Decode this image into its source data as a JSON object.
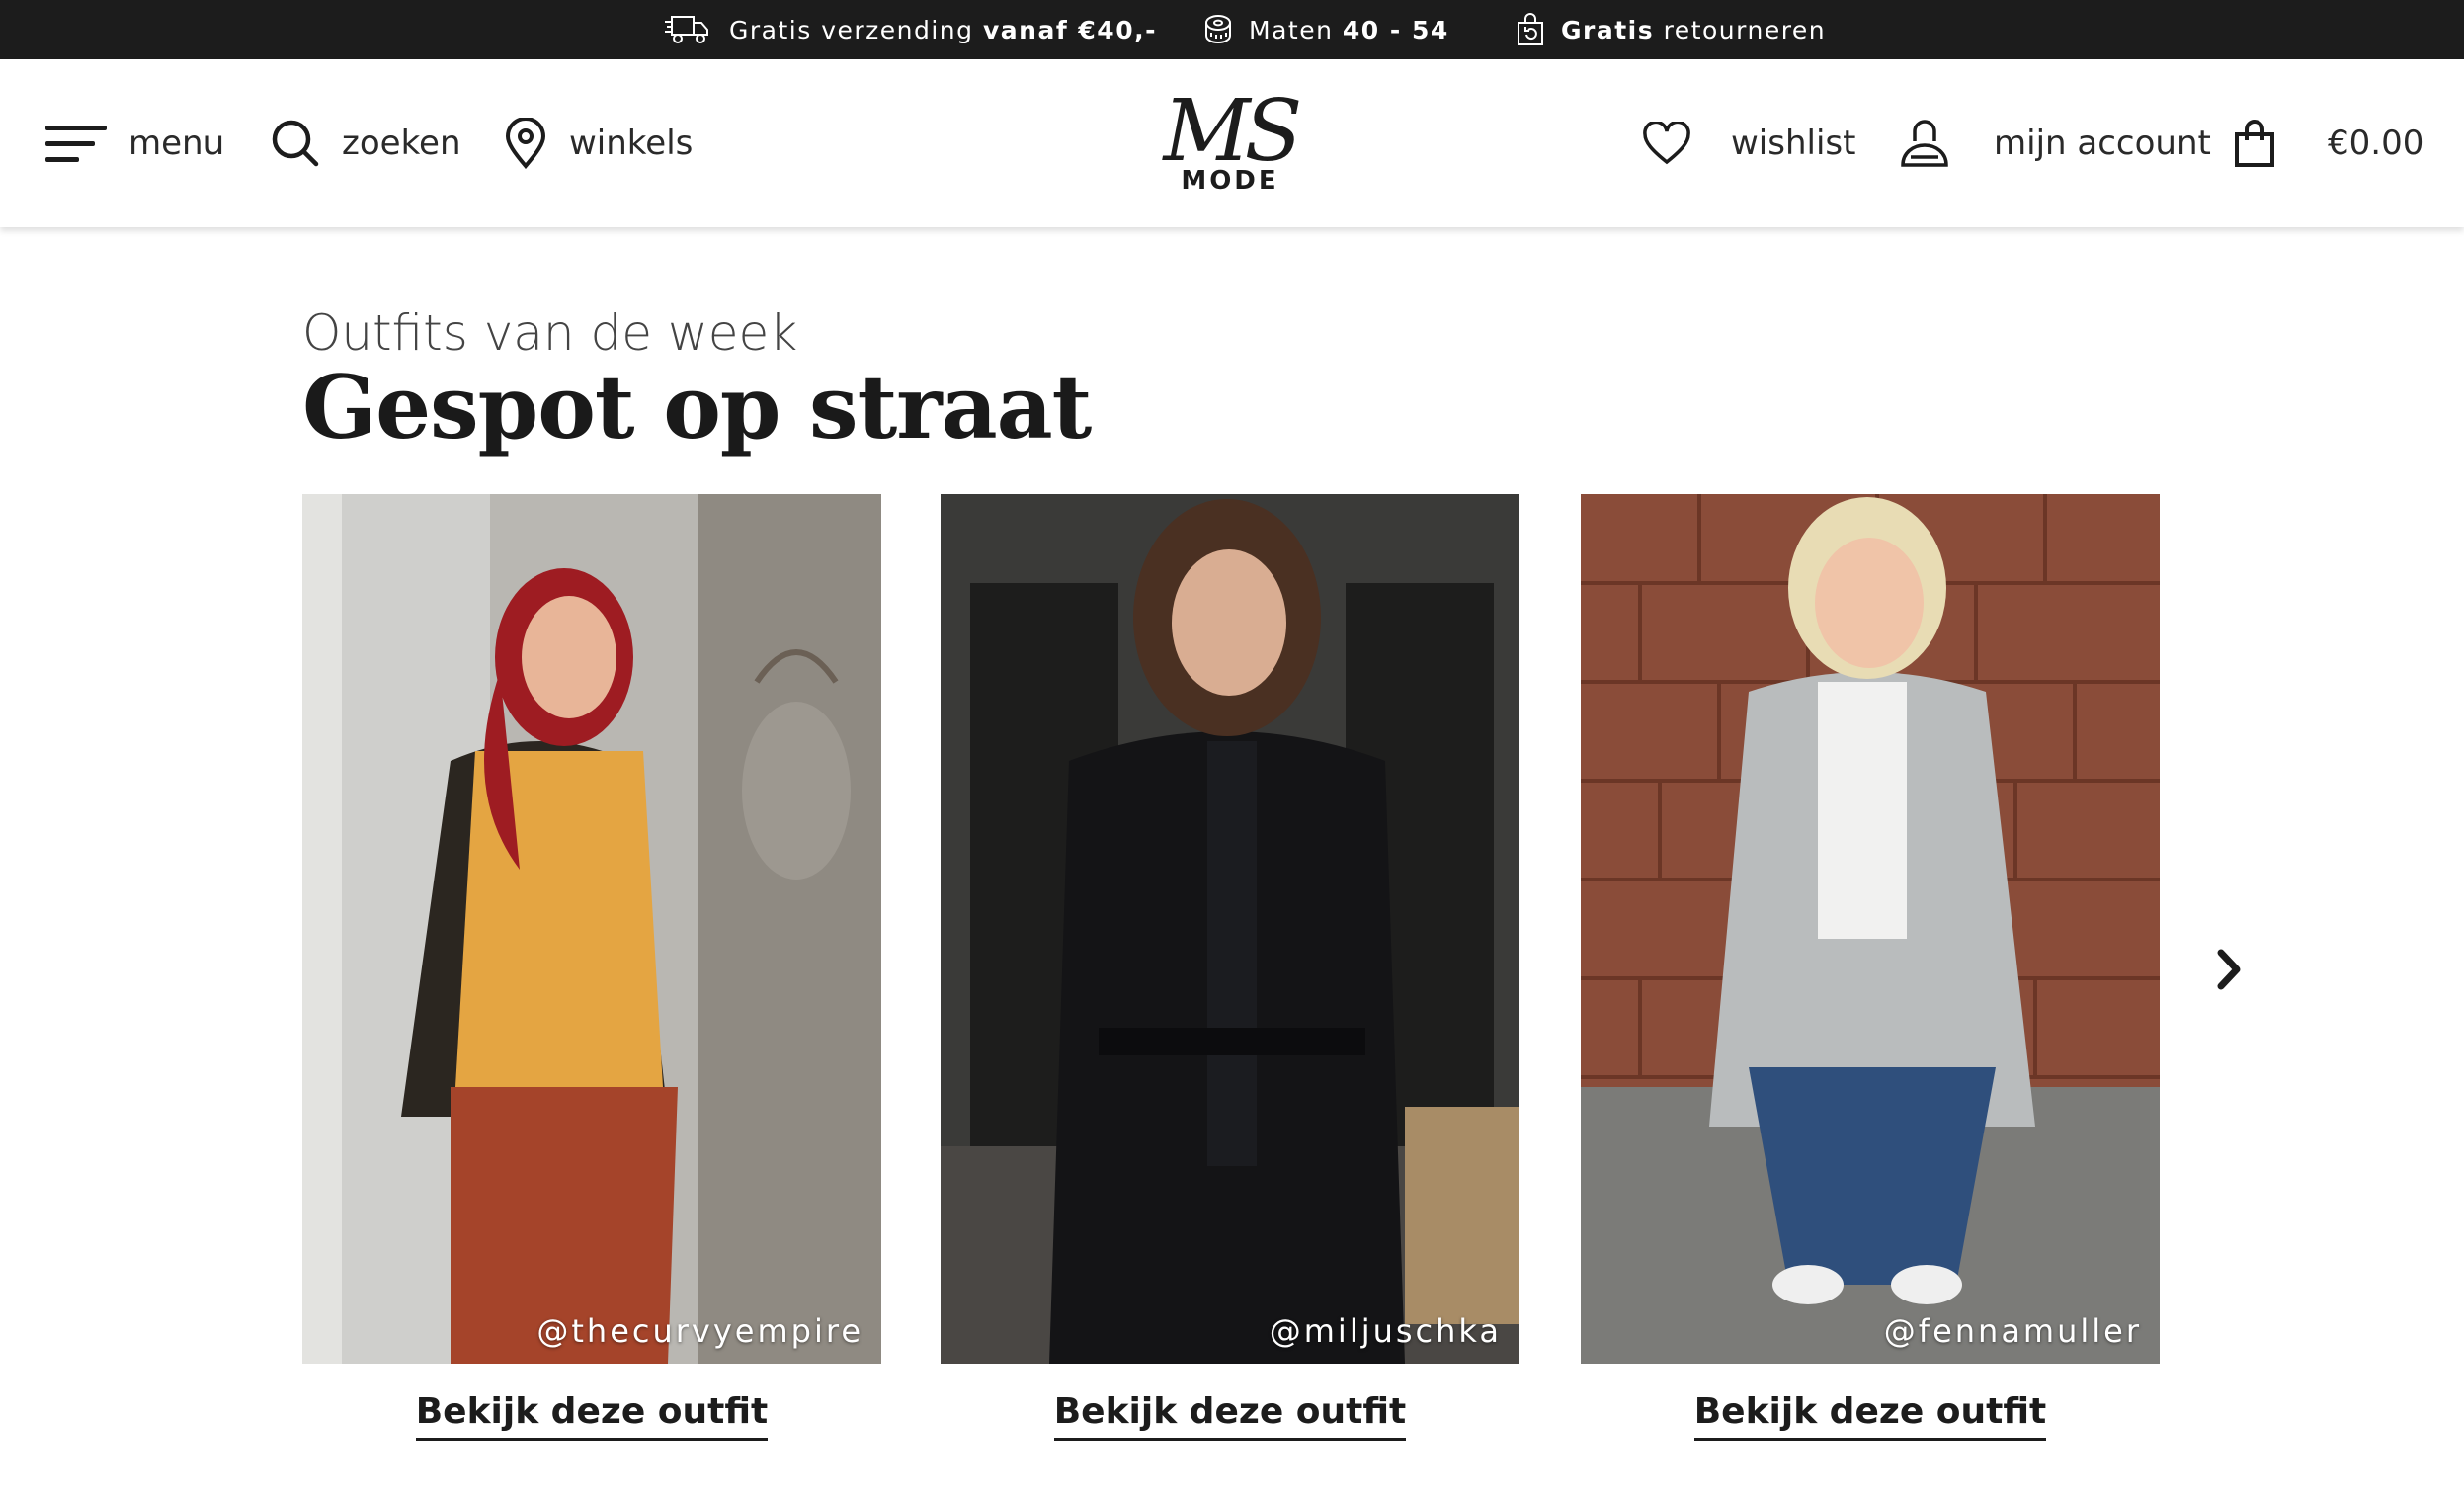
{
  "usp_bar": {
    "shipping": {
      "prefix": "Gratis verzending",
      "bold": "vanaf €40,-",
      "icon": "truck-icon"
    },
    "sizes": {
      "prefix": "Maten",
      "bold": "40 - 54",
      "icon": "measuring-tape-icon"
    },
    "returns": {
      "bold": "Gratis",
      "suffix": "retourneren",
      "icon": "return-bag-icon"
    }
  },
  "header": {
    "menu_label": "menu",
    "search_label": "zoeken",
    "stores_label": "winkels",
    "logo": {
      "mark": "MS",
      "sub": "MODE"
    },
    "wishlist_label": "wishlist",
    "account_label": "mijn account",
    "cart_total": "€0.00"
  },
  "section": {
    "kicker": "Outfits van de week",
    "title": "Gespot op straat"
  },
  "outfits": [
    {
      "handle": "@thecurvyempire",
      "cta": "Bekijk deze outfit"
    },
    {
      "handle": "@miljuschka",
      "cta": "Bekijk deze outfit"
    },
    {
      "handle": "@fennamuller",
      "cta": "Bekijk deze outfit"
    }
  ],
  "colors": {
    "dark": "#1c1c1c",
    "white": "#ffffff"
  }
}
